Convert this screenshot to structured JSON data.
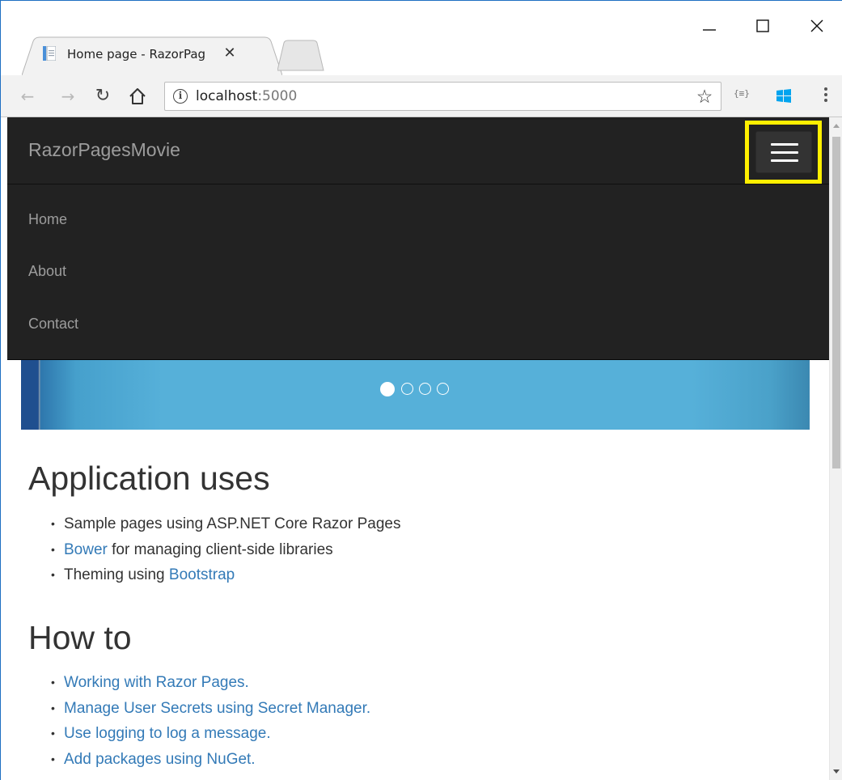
{
  "browser": {
    "tab_title": "Home page - RazorPages",
    "url_host": "localhost",
    "url_port": ":5000",
    "ext_json_label": "{≡}"
  },
  "navbar": {
    "brand": "RazorPagesMovie",
    "links": [
      "Home",
      "About",
      "Contact"
    ]
  },
  "carousel": {
    "slide_count": 4,
    "active_index": 0
  },
  "sections": [
    {
      "heading": "Application uses",
      "items": [
        {
          "text": "Sample pages using ASP.NET Core Razor Pages"
        },
        {
          "link": "Bower",
          "text": " for managing client-side libraries"
        },
        {
          "text": "Theming using ",
          "link_after": "Bootstrap"
        }
      ]
    },
    {
      "heading": "How to",
      "items": [
        {
          "link": "Working with Razor Pages."
        },
        {
          "link": "Manage User Secrets using Secret Manager."
        },
        {
          "link": "Use logging to log a message."
        },
        {
          "link": "Add packages using NuGet."
        }
      ]
    }
  ],
  "colors": {
    "navbar_bg": "#222222",
    "highlight": "#ffef00",
    "link": "#337ab7"
  }
}
